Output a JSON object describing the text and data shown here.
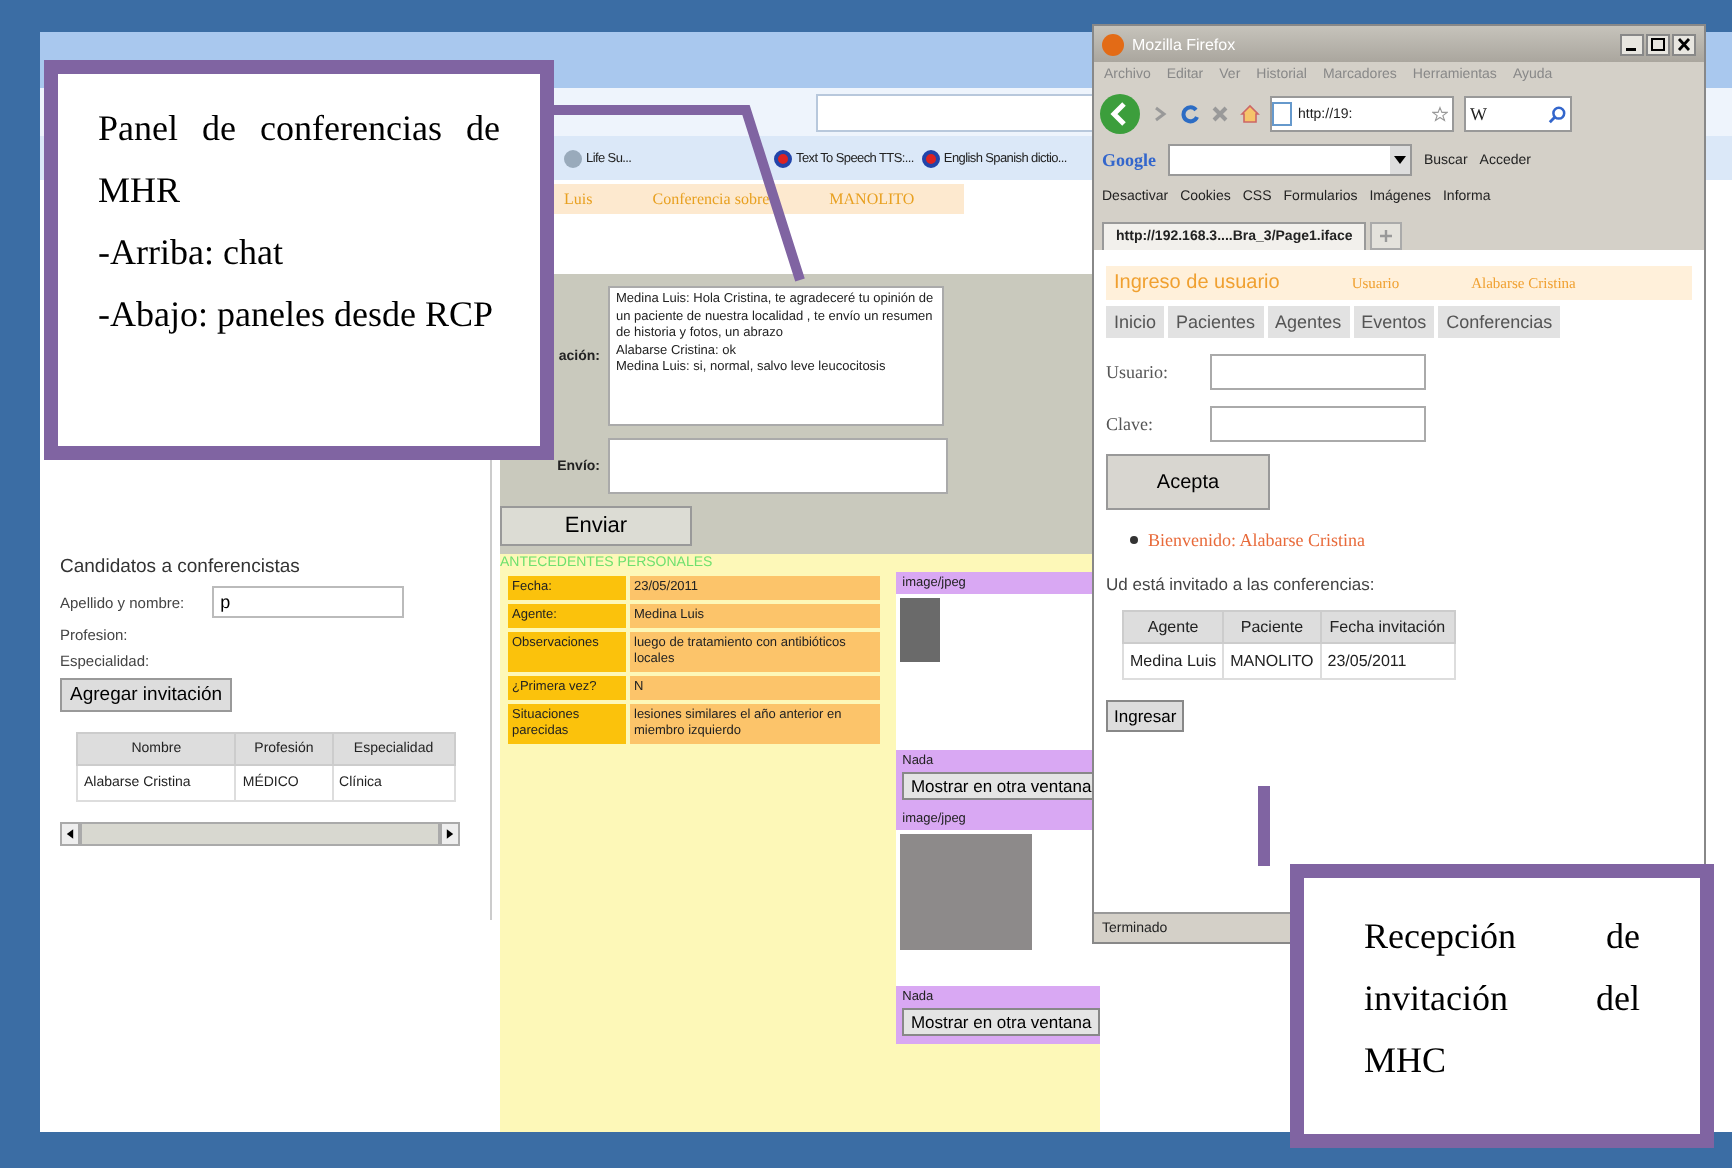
{
  "chrome_window": {
    "bookmarks": [
      {
        "label": "Life Su..."
      },
      {
        "label": "Text To Speech TTS:..."
      },
      {
        "label": "English Spanish dictio..."
      }
    ],
    "conference_header": {
      "agent": "Luis",
      "title": "Conferencia sobre",
      "patient": "MANOLITO"
    },
    "chat": {
      "conversation_label": "ación:",
      "messages": [
        "Medina Luis: Hola Cristina, te agradeceré tu opinión de un paciente de nuestra localidad , te envío un resumen de historia y fotos, un abrazo",
        "Alabarse Cristina: ok",
        "Medina Luis: si, normal, salvo leve leucocitosis"
      ],
      "send_label": "Envío:",
      "send_button": "Enviar"
    },
    "candidates": {
      "title": "Candidatos a conferencistas",
      "name_label": "Apellido y nombre:",
      "name_value": "p",
      "profession_label": "Profesion:",
      "specialty_label": "Especialidad:",
      "add_button": "Agregar invitación",
      "columns": [
        "Nombre",
        "Profesión",
        "Especialidad"
      ],
      "rows": [
        [
          "Alabarse Cristina",
          "MÉDICO",
          "Clínica"
        ]
      ]
    },
    "antecedents": {
      "title": "ANTECEDENTES PERSONALES",
      "rows": [
        {
          "label": "Fecha:",
          "value": "23/05/2011"
        },
        {
          "label": "Agente:",
          "value": "Medina Luis"
        },
        {
          "label": "Observaciones",
          "value": "luego de tratamiento con antibióticos locales"
        },
        {
          "label": "¿Primera vez?",
          "value": "N"
        },
        {
          "label": "Situaciones parecidas",
          "value": "lesiones similares el año anterior en miembro izquierdo"
        }
      ]
    },
    "attachments": [
      {
        "type": "image/jpeg",
        "caption": "Nada",
        "button": "Mostrar en otra ventana"
      },
      {
        "type": "image/jpeg",
        "caption": "Nada",
        "button": "Mostrar en otra ventana"
      }
    ]
  },
  "firefox_window": {
    "title": "Mozilla Firefox",
    "menu": [
      "Archivo",
      "Editar",
      "Ver",
      "Historial",
      "Marcadores",
      "Herramientas",
      "Ayuda"
    ],
    "url": "http://19:",
    "search_engine": "W",
    "google_logo": "Google",
    "google_buttons": [
      "Buscar",
      "Acceder"
    ],
    "devbar": [
      "Desactivar",
      "Cookies",
      "CSS",
      "Formularios",
      "Imágenes",
      "Informa"
    ],
    "tab": "http://192.168.3....Bra_3/Page1.iface",
    "page": {
      "header_title": "Ingreso de usuario",
      "header_user_label": "Usuario",
      "header_user": "Alabarse Cristina",
      "nav": [
        {
          "label": "Inicio",
          "selected": false
        },
        {
          "label": "Pacientes",
          "selected": false
        },
        {
          "label": "Agentes",
          "selected": false
        },
        {
          "label": "Eventos",
          "selected": false
        },
        {
          "label": "Conferencias",
          "selected": false
        }
      ],
      "user_label": "Usuario:",
      "password_label": "Clave:",
      "accept_button": "Acepta",
      "welcome": "Bienvenido: Alabarse Cristina",
      "invited_text": "Ud está invitado a las conferencias:",
      "columns": [
        "Agente",
        "Paciente",
        "Fecha invitación"
      ],
      "rows": [
        [
          "Medina Luis",
          "MANOLITO",
          "23/05/2011"
        ]
      ],
      "enter_button": "Ingresar"
    },
    "status": "Terminado"
  },
  "callouts": [
    {
      "paragraphs": [
        "Panel de conferencias de MHR",
        "-Arriba: chat",
        "-Abajo: paneles desde RCP"
      ]
    },
    {
      "paragraphs": [
        "Recepción de invitación del MHC"
      ]
    }
  ]
}
